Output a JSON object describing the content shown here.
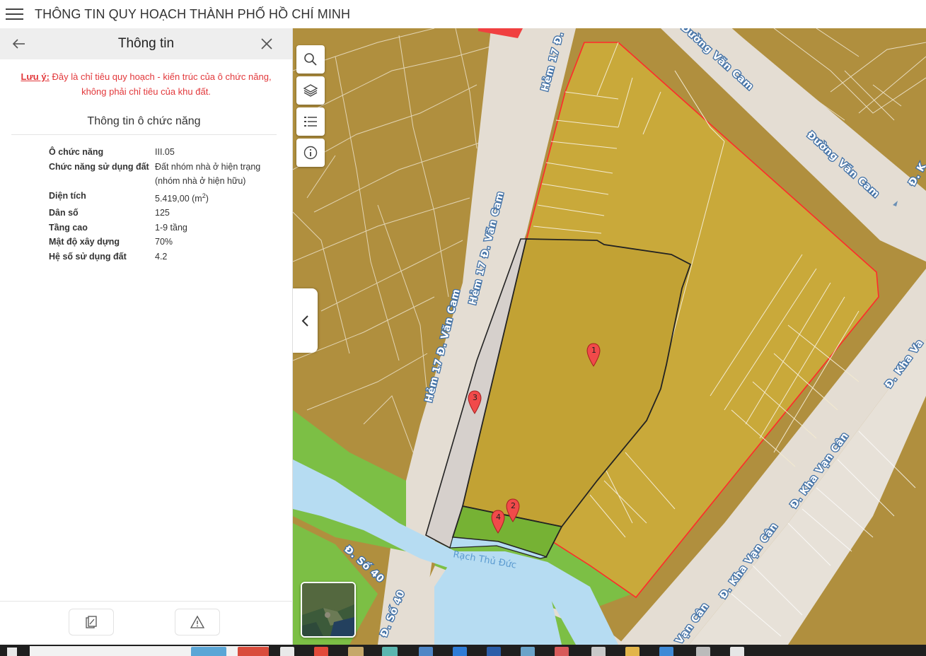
{
  "header": {
    "title": "THÔNG TIN QUY HOẠCH THÀNH PHỐ HỒ CHÍ MINH"
  },
  "panel": {
    "title": "Thông tin",
    "note_label": "Lưu ý:",
    "note_text": " Đây là chỉ tiêu quy hoạch - kiến trúc của ô chức năng,",
    "note_text2": "không phải chỉ tiêu của khu đất.",
    "section_title": "Thông tin ô chức năng",
    "rows": [
      {
        "label": "Ô chức năng",
        "value": "III.05"
      },
      {
        "label": "Chức năng sử dụng đất",
        "value": "Đất nhóm nhà ở hiện trạng (nhóm nhà ở hiện hữu)"
      },
      {
        "label": "Diện tích",
        "value": "5.419,00 (m",
        "sup": "2",
        "value_suffix": ")"
      },
      {
        "label": "Dân số",
        "value": "125"
      },
      {
        "label": "Tầng cao",
        "value": "1-9 tầng"
      },
      {
        "label": "Mật độ xây dựng",
        "value": "70%"
      },
      {
        "label": "Hệ số sử dụng đất",
        "value": "4.2"
      }
    ]
  },
  "map": {
    "streets": {
      "hem17_1": "Hẻm 17 Đ. V",
      "hem17_2": "Hẻm 17 Đ. Văn Cam",
      "hem17_3": "Hẻm 17 Đ. Văn Cam",
      "duong_van_cam_1": "Đường Văn Cam",
      "duong_van_cam_2": "Đường Văn Cam",
      "kha_van_can_1": "Đ. Kha Va",
      "kha_van_can_2": "Đ. Kha Vạn Cân",
      "kha_van_can_3": "Đ. Kha Vạn Cân",
      "kha_van_can_4": "Vạn Cân",
      "dk_partial": "Đ. K",
      "so40_1": "Đ. Số 40",
      "so40_2": "Đ. Số 40",
      "rach": "Rạch Thủ Đức"
    },
    "markers": [
      "1",
      "2",
      "3",
      "4"
    ],
    "colors": {
      "parcel": "#b08f3e",
      "selected_fill": "#c9a93a",
      "highlight_outline": "#ff2a2a",
      "green": "#7cbf45",
      "water": "#b6dcf2",
      "road": "#e6e1da"
    }
  }
}
